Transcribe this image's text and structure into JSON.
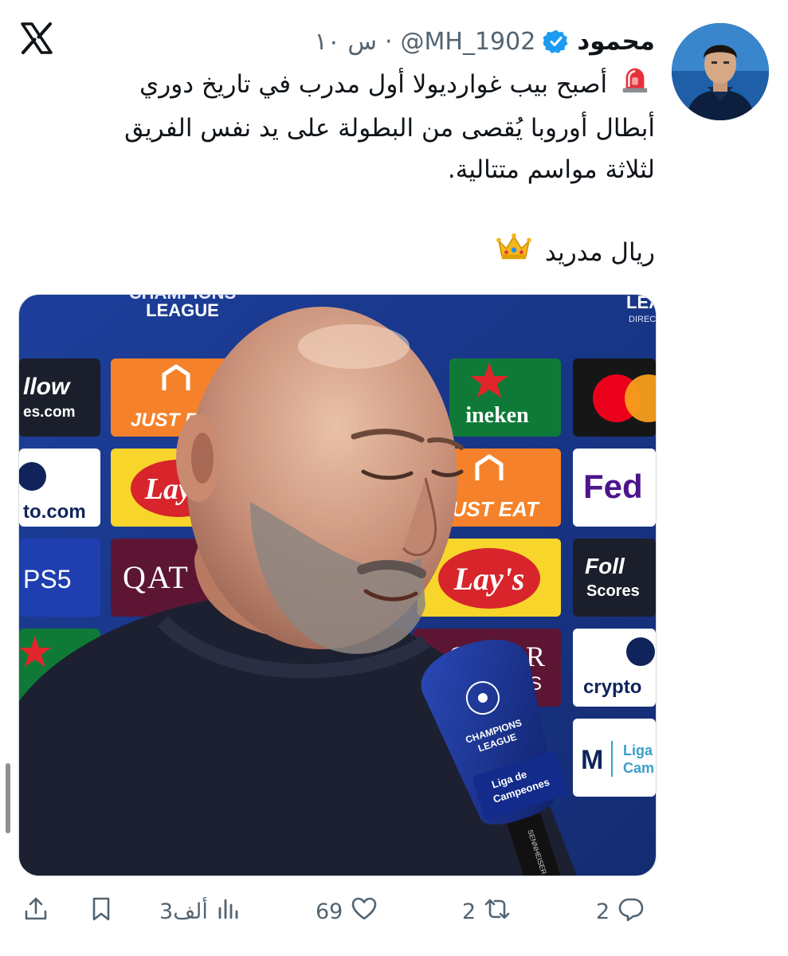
{
  "author": {
    "display_name": "محمود",
    "handle": "@MH_1902",
    "time": "س ١٠",
    "verified": true
  },
  "platform": {
    "icon": "x-logo-icon"
  },
  "tweet": {
    "line1": "أصبح بيب غوارديولا أول مدرب في تاريخ دوري",
    "line2": "أبطال أوروبا يُقصى من البطولة على يد نفس الفريق",
    "line3": "لثلاثة مواسم متتالية.",
    "line4": "ريال مدريد",
    "emojis": [
      "siren-emoji",
      "crown-emoji"
    ]
  },
  "media": {
    "board_texts": [
      "CHAMPIONS",
      "LEAGUE",
      "llow",
      "es.com",
      "JUST EAT",
      "ineken",
      "Lay's",
      "to.com",
      "Fed",
      "JUST EAT",
      "PS5",
      "QAT",
      "Lay's",
      "Foll",
      "Scores",
      "QATAR",
      "WAYS",
      "crypto",
      "Liga",
      "Cam",
      "LEA",
      "DIREC"
    ],
    "mic_texts": [
      "CHAMPIONS",
      "LEAGUE",
      "Liga de",
      "Campeones",
      "SENNHEISER"
    ]
  },
  "actions": {
    "replies": "2",
    "reposts": "2",
    "likes": "69",
    "views": "3ألف"
  },
  "colors": {
    "accent": "#1d9bf0",
    "text": "#0f1419",
    "muted": "#536471",
    "board_blue": "#1a3a8f"
  }
}
